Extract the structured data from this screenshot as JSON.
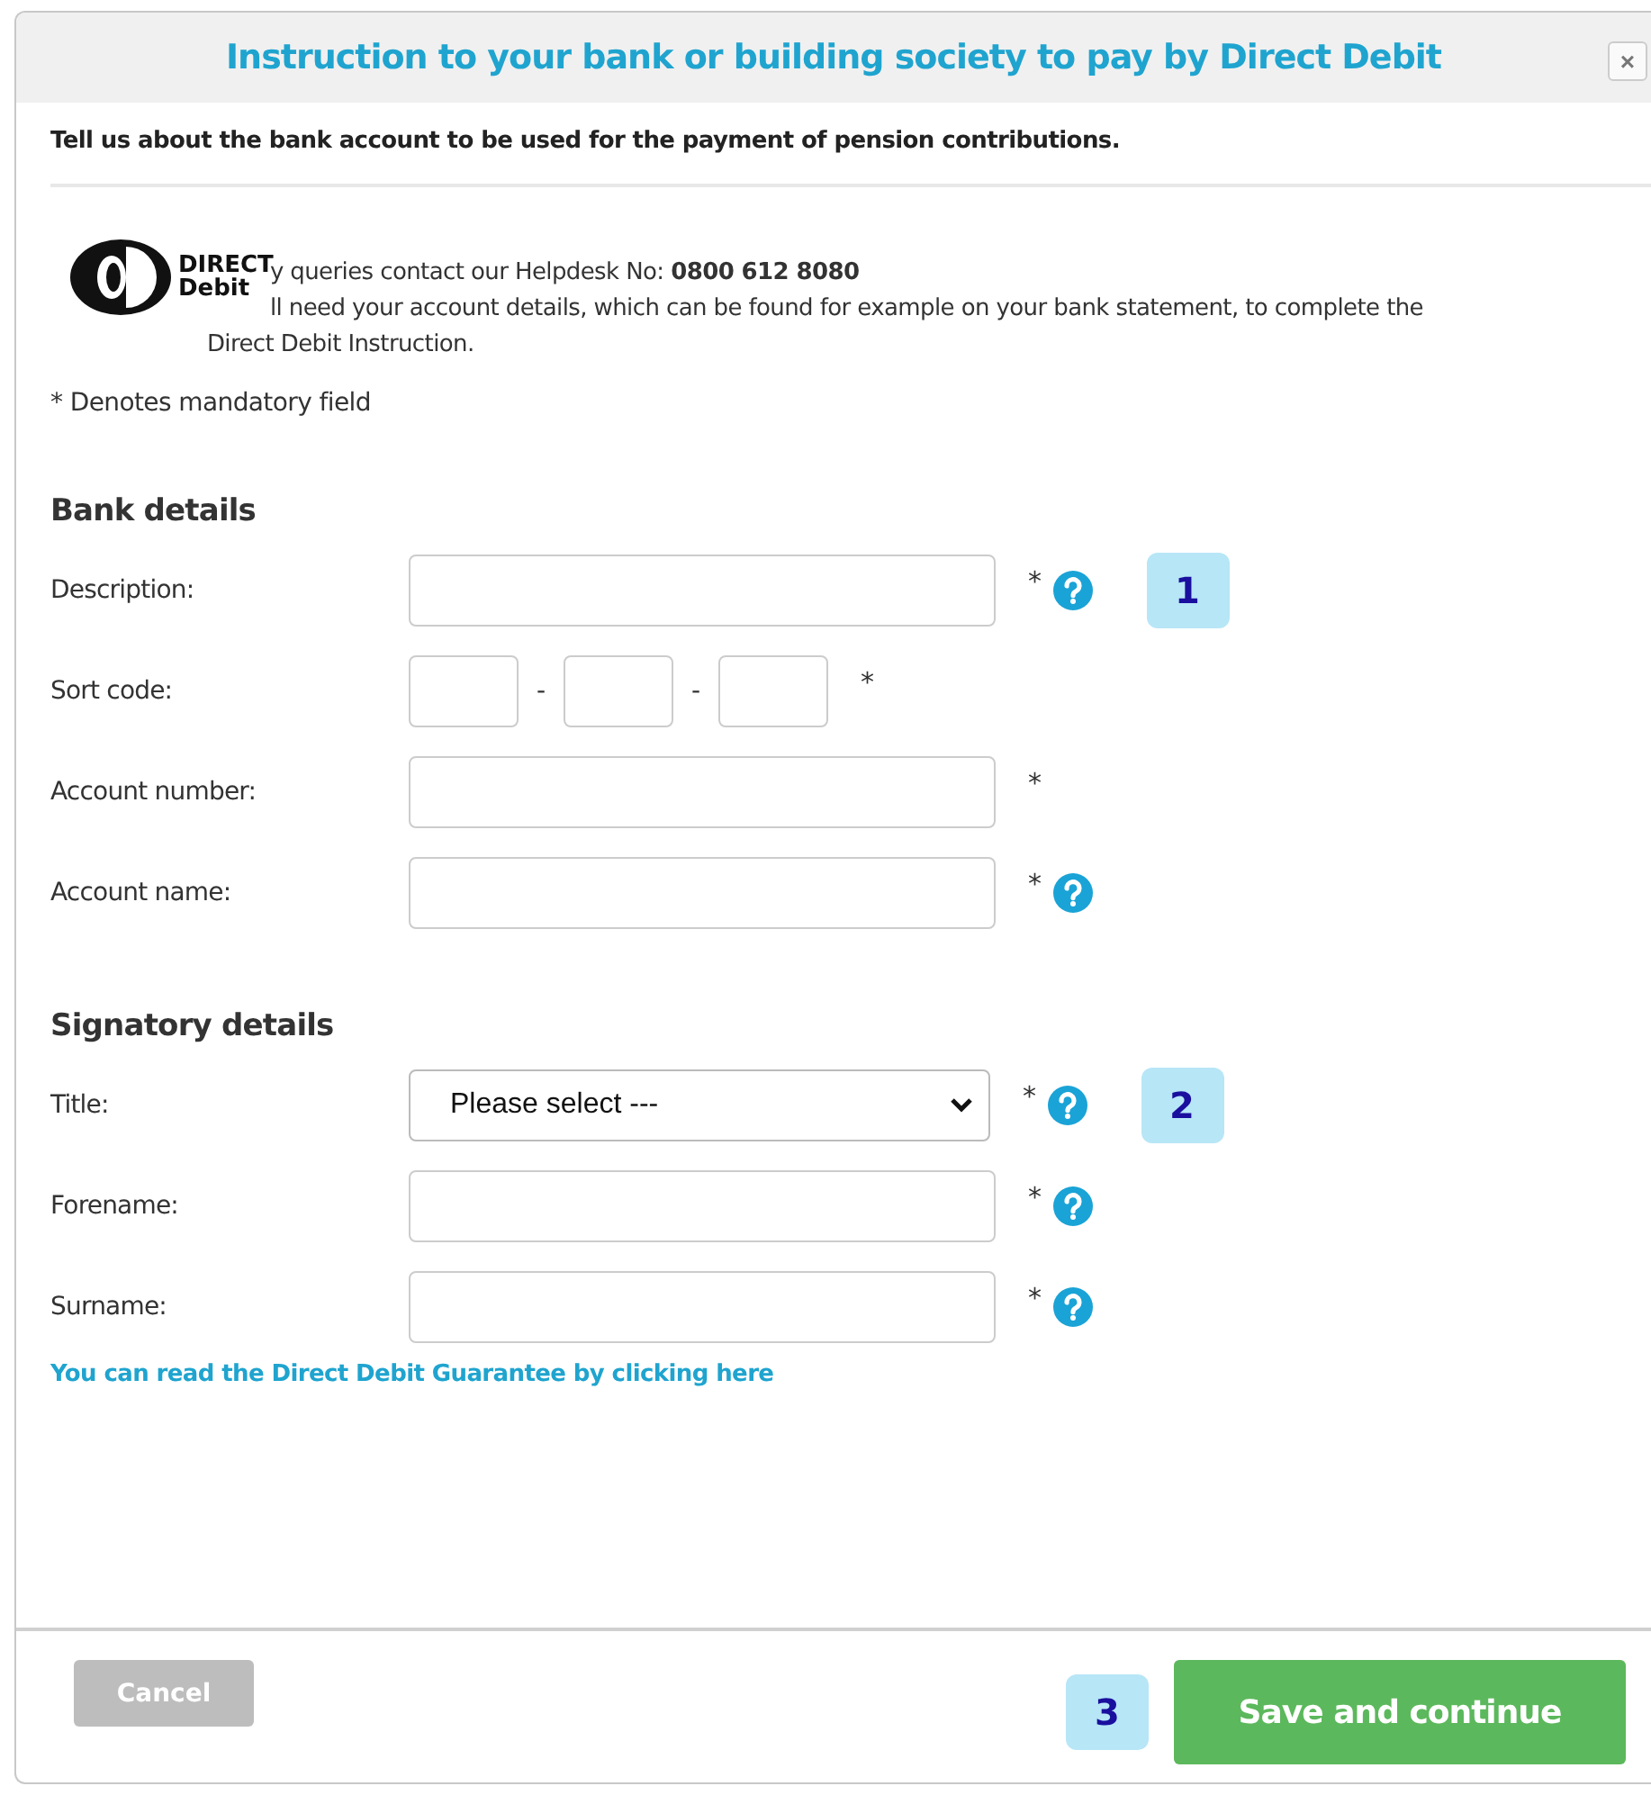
{
  "dialog": {
    "title": "Instruction to your bank or building society to pay by Direct Debit",
    "close": "×"
  },
  "intro": "Tell us about the bank account to be used for the payment of pension contributions.",
  "logo": {
    "line_1": "DIRECT",
    "line_2": "Debit"
  },
  "info_lines": [
    "y queries contact our Helpdesk No: **0800 612 8080**",
    "ll need your account details, which can be found for example on your bank statement, to complete the",
    "Direct Debit Instruction."
  ],
  "mandatory_note": "* Denotes mandatory field",
  "sections": [
    {
      "heading": "Bank details",
      "fields": [
        {
          "kind": "text",
          "label": "Description:",
          "required": "*",
          "help": true,
          "callout": "1"
        },
        {
          "kind": "sortcode",
          "label": "Sort code:",
          "separators": [
            "-",
            "-"
          ],
          "required": "*",
          "help": false
        },
        {
          "kind": "text",
          "label": "Account number:",
          "required": "*",
          "help": false
        },
        {
          "kind": "text",
          "label": "Account name:",
          "required": "*",
          "help": true
        }
      ]
    },
    {
      "heading": "Signatory details",
      "fields": [
        {
          "kind": "select",
          "label": "Title:",
          "value": "Please select ---",
          "required": "*",
          "help": true,
          "callout": "2"
        },
        {
          "kind": "text",
          "label": "Forename:",
          "required": "*",
          "help": true
        },
        {
          "kind": "text",
          "label": "Surname:",
          "required": "*",
          "help": true
        }
      ]
    }
  ],
  "guarantee_link": "You can read the Direct Debit Guarantee by clicking here",
  "footer": {
    "cancel": {
      "label": "Cancel",
      "disabled": true
    },
    "callout": "3",
    "save": {
      "label": "Save and continue",
      "disabled": false
    }
  }
}
